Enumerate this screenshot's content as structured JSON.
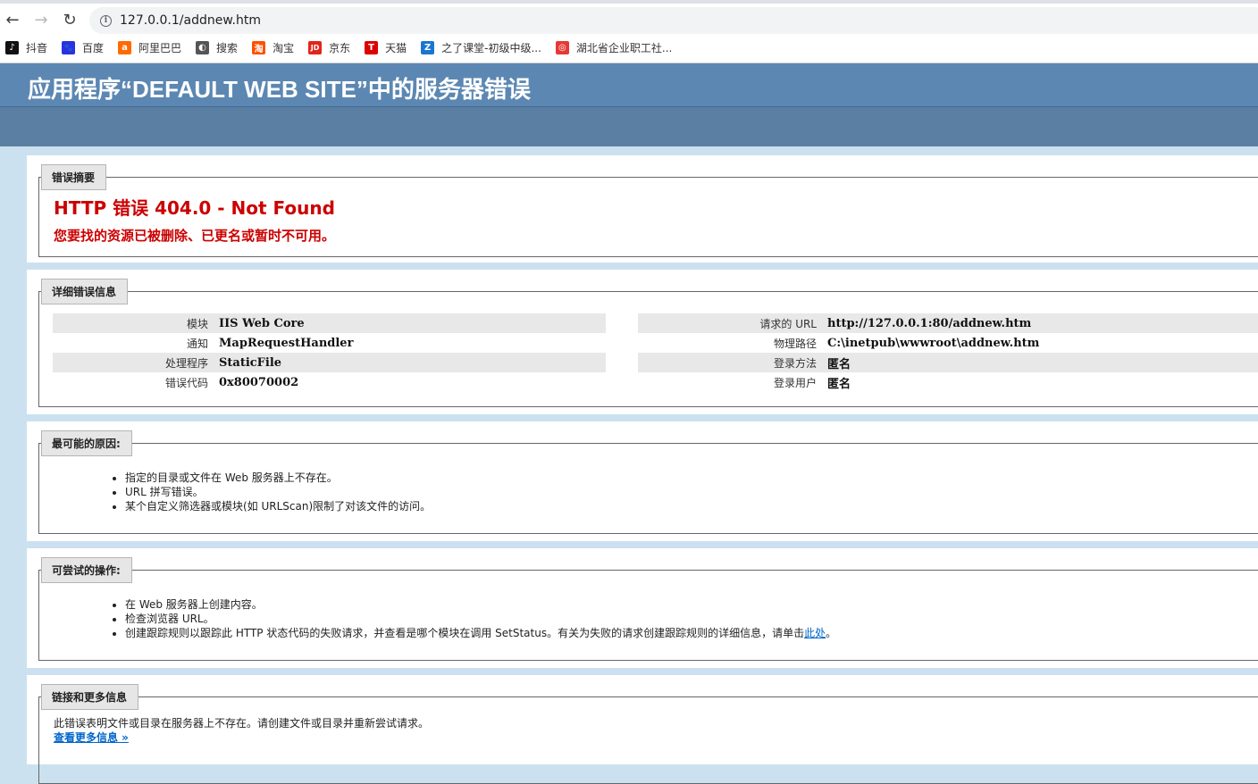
{
  "browser": {
    "url": "127.0.0.1/addnew.htm",
    "bookmarks": [
      {
        "label": "抖音",
        "icon": "douyin-icon",
        "color": "#111111",
        "glyph": "♪"
      },
      {
        "label": "百度",
        "icon": "baidu-paw-icon",
        "color": "#2932e1",
        "glyph": "🐾"
      },
      {
        "label": "阿里巴巴",
        "icon": "alibaba-icon",
        "color": "#ff6a00",
        "glyph": "a"
      },
      {
        "label": "搜索",
        "icon": "globe-icon",
        "color": "#555555",
        "glyph": "◐"
      },
      {
        "label": "淘宝",
        "icon": "taobao-icon",
        "color": "#ff5000",
        "glyph": "淘"
      },
      {
        "label": "京东",
        "icon": "jd-icon",
        "color": "#e1251b",
        "glyph": "JD"
      },
      {
        "label": "天猫",
        "icon": "tmall-icon",
        "color": "#dd0000",
        "glyph": "T"
      },
      {
        "label": "之了课堂-初级中级...",
        "icon": "zhiliao-icon",
        "color": "#1976d2",
        "glyph": "Z"
      },
      {
        "label": "湖北省企业职工社...",
        "icon": "hubei-icon",
        "color": "#e53935",
        "glyph": "◎"
      }
    ]
  },
  "page": {
    "title": "应用程序“DEFAULT WEB SITE”中的服务器错误",
    "summary": {
      "legend": "错误摘要",
      "error_title": "HTTP 错误 404.0 - Not Found",
      "error_message": "您要找的资源已被删除、已更名或暂时不可用。"
    },
    "details": {
      "legend": "详细错误信息",
      "left": [
        {
          "key": "模块",
          "value": "IIS Web Core"
        },
        {
          "key": "通知",
          "value": "MapRequestHandler"
        },
        {
          "key": "处理程序",
          "value": "StaticFile"
        },
        {
          "key": "错误代码",
          "value": "0x80070002"
        }
      ],
      "right": [
        {
          "key": "请求的 URL",
          "value": "http://127.0.0.1:80/addnew.htm"
        },
        {
          "key": "物理路径",
          "value": "C:\\inetpub\\wwwroot\\addnew.htm"
        },
        {
          "key": "登录方法",
          "value": "匿名"
        },
        {
          "key": "登录用户",
          "value": "匿名"
        }
      ]
    },
    "causes": {
      "legend": "最可能的原因:",
      "items": [
        "指定的目录或文件在 Web 服务器上不存在。",
        "URL 拼写错误。",
        "某个自定义筛选器或模块(如 URLScan)限制了对该文件的访问。"
      ]
    },
    "actions": {
      "legend": "可尝试的操作:",
      "item1": "在 Web 服务器上创建内容。",
      "item2": "检查浏览器 URL。",
      "item3_text": "创建跟踪规则以跟踪此 HTTP 状态代码的失败请求，并查看是哪个模块在调用 SetStatus。有关为失败的请求创建跟踪规则的详细信息，请单击",
      "item3_link": "此处",
      "item3_end": "。"
    },
    "links": {
      "legend": "链接和更多信息",
      "text": "此错误表明文件或目录在服务器上不存在。请创建文件或目录并重新尝试请求。",
      "more": "查看更多信息 »"
    }
  }
}
